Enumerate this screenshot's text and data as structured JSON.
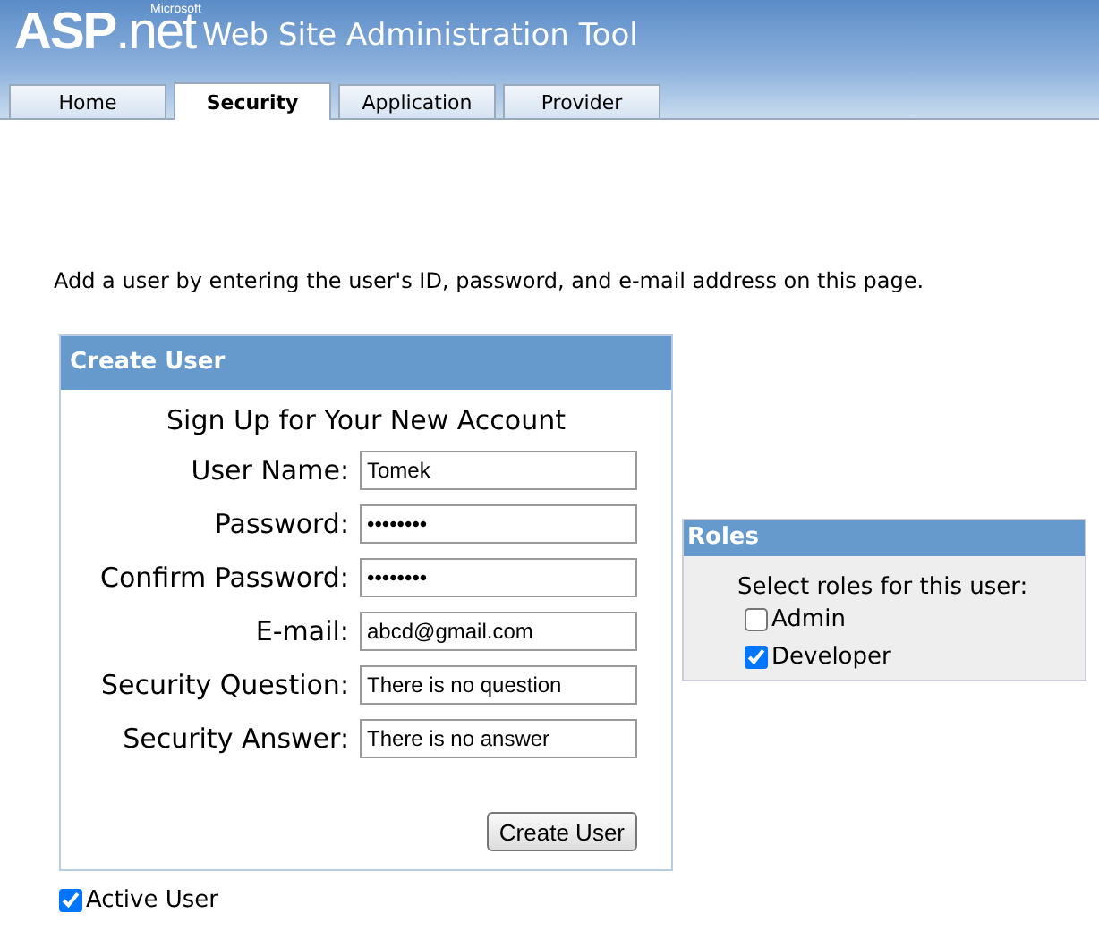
{
  "header": {
    "logo": {
      "main": "ASP",
      "suffix": ".net",
      "brand": "Microsoft"
    },
    "title": "Web Site Administration Tool"
  },
  "tabs": [
    {
      "label": "Home",
      "selected": false
    },
    {
      "label": "Security",
      "selected": true
    },
    {
      "label": "Application",
      "selected": false
    },
    {
      "label": "Provider",
      "selected": false
    }
  ],
  "instruction": "Add a user by entering the user's ID, password, and e-mail address on this page.",
  "create_user": {
    "title": "Create User",
    "heading": "Sign Up for Your New Account",
    "fields": [
      {
        "label": "User Name:",
        "value": "Tomek"
      },
      {
        "label": "Password:",
        "value": "••••••••"
      },
      {
        "label": "Confirm Password:",
        "value": "••••••••"
      },
      {
        "label": "E-mail:",
        "value": "abcd@gmail.com"
      },
      {
        "label": "Security Question:",
        "value": "There is no question"
      },
      {
        "label": "Security Answer:",
        "value": "There is no answer"
      }
    ],
    "button": "Create User"
  },
  "active_user": {
    "label": "Active User",
    "checked": true
  },
  "roles": {
    "title": "Roles",
    "prompt": "Select roles for this user:",
    "items": [
      {
        "label": "Admin",
        "checked": false
      },
      {
        "label": "Developer",
        "checked": true
      }
    ]
  }
}
